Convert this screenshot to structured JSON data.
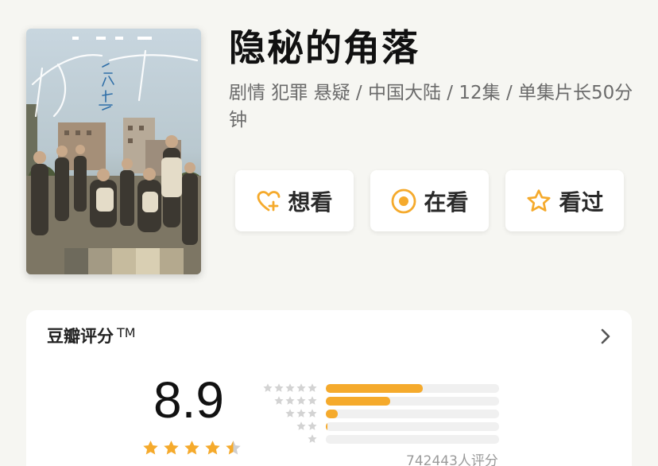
{
  "movie": {
    "title": "隐秘的角落",
    "meta": "剧情 犯罪 悬疑 / 中国大陆 / 12集 / 单集片长50分钟"
  },
  "actions": {
    "want": {
      "label": "想看",
      "icon": "heart-plus-icon"
    },
    "watching": {
      "label": "在看",
      "icon": "target-icon"
    },
    "watched": {
      "label": "看过",
      "icon": "star-outline-icon"
    }
  },
  "rating": {
    "title": "豆瓣评分",
    "trademark": "TM",
    "score": "8.9",
    "stars": 4.5,
    "distribution": [
      {
        "stars": 5,
        "fraction": 0.56
      },
      {
        "stars": 4,
        "fraction": 0.37
      },
      {
        "stars": 3,
        "fraction": 0.07
      },
      {
        "stars": 2,
        "fraction": 0.01
      },
      {
        "stars": 1,
        "fraction": 0.0
      }
    ],
    "count": "742443人评分"
  },
  "colors": {
    "accent": "#f5aa2c",
    "background": "#f6f6f2"
  }
}
